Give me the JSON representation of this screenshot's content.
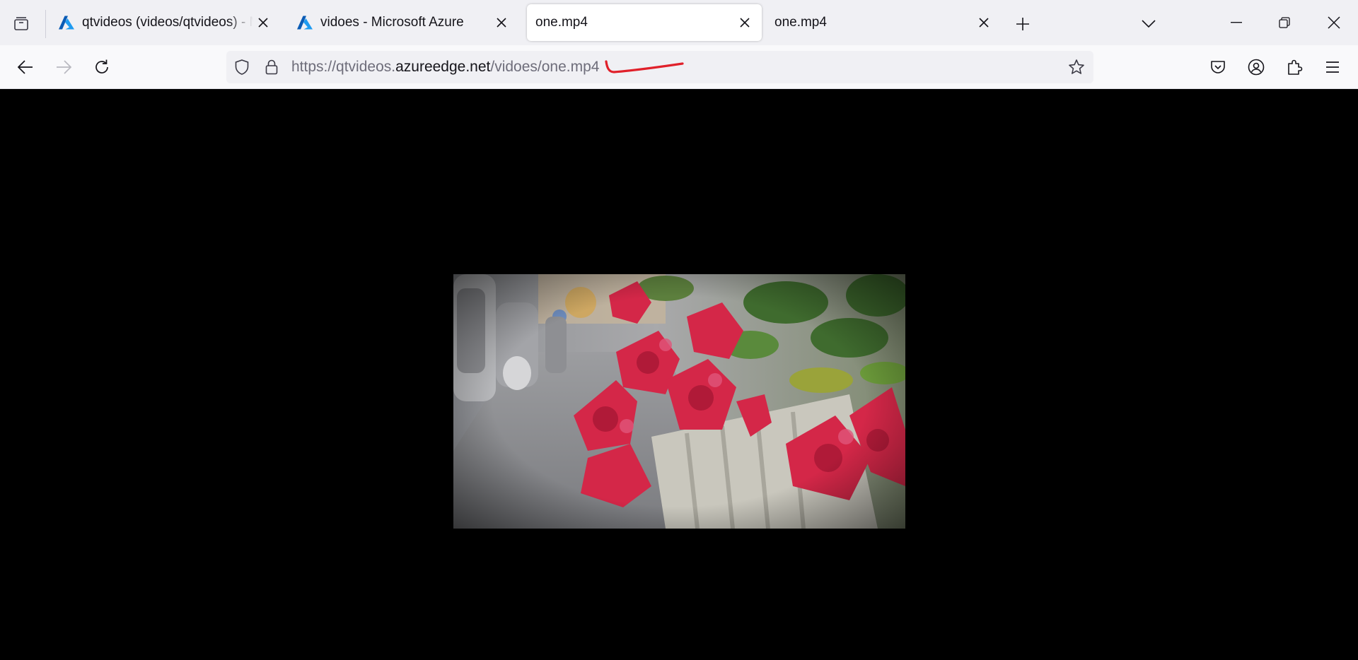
{
  "tabs": [
    {
      "label": "qtvideos (videos/qtvideos) - Microsoft Azure",
      "favicon": "azure-icon",
      "active": false
    },
    {
      "label": "vidoes - Microsoft Azure",
      "favicon": "azure-icon",
      "active": false
    },
    {
      "label": "one.mp4",
      "favicon": "none",
      "active": true
    },
    {
      "label": "one.mp4",
      "favicon": "none",
      "active": false
    }
  ],
  "address_bar": {
    "url_prefix": "https://qtvideos.",
    "url_host": "azureedge.net",
    "url_path": "/vidoes/one.mp4"
  },
  "icons": {
    "tab_list": "tab-list-icon",
    "new_tab": "plus-icon",
    "all_tabs": "chevron-down-icon",
    "minimize": "minimize-icon",
    "restore": "restore-icon",
    "close_window": "close-icon",
    "back": "arrow-left-icon",
    "forward": "arrow-right-icon",
    "reload": "reload-icon",
    "tracking_protection": "shield-icon",
    "secure": "lock-icon",
    "bookmark": "star-icon",
    "pocket": "pocket-icon",
    "account": "account-icon",
    "extensions": "puzzle-icon",
    "menu": "hamburger-menu-icon"
  },
  "colors": {
    "tabstrip_bg": "#f0f0f4",
    "toolbar_bg": "#f9f9fb",
    "azure_blue": "#0078d4",
    "annotation_red": "#e0202a",
    "content_bg": "#000000"
  },
  "video": {
    "description_icon": "video-frame-red-flowers"
  }
}
